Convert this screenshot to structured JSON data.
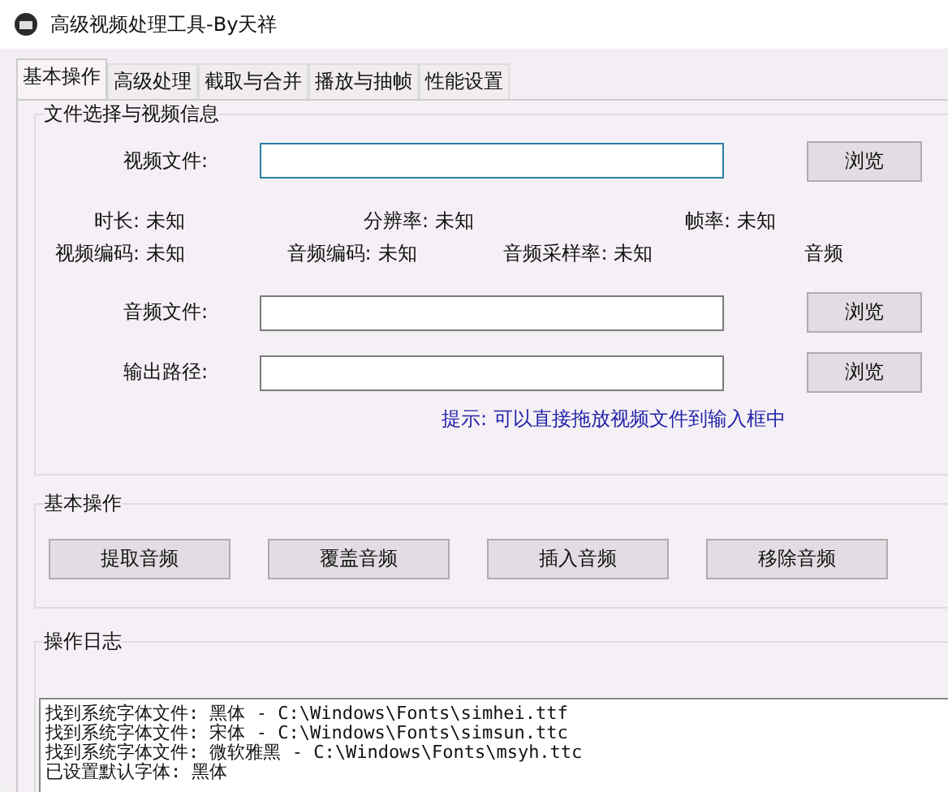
{
  "window": {
    "title": "高级视频处理工具-By天祥"
  },
  "tabs": [
    {
      "label": "基本操作",
      "selected": true
    },
    {
      "label": "高级处理",
      "selected": false
    },
    {
      "label": "截取与合并",
      "selected": false
    },
    {
      "label": "播放与抽帧",
      "selected": false
    },
    {
      "label": "性能设置",
      "selected": false
    }
  ],
  "file_group": {
    "title": "文件选择与视频信息",
    "file_rows": [
      {
        "label": "视频文件:",
        "focused": true,
        "button": "浏览"
      },
      {
        "label": "音频文件:",
        "focused": false,
        "button": "浏览"
      },
      {
        "label": "输出路径:",
        "focused": false,
        "button": "浏览"
      }
    ],
    "info_rows": [
      [
        {
          "label": "时长:",
          "value": "未知"
        },
        {
          "label": "分辨率:",
          "value": "未知"
        },
        {
          "label": "帧率:",
          "value": "未知"
        }
      ],
      [
        {
          "label": "视频编码:",
          "value": "未知"
        },
        {
          "label": "音频编码:",
          "value": "未知"
        },
        {
          "label": "音频采样率:",
          "value": "未知"
        },
        {
          "label": "音频"
        }
      ]
    ],
    "hint": "提示: 可以直接拖放视频文件到输入框中"
  },
  "ops_group": {
    "title": "基本操作",
    "buttons": [
      "提取音频",
      "覆盖音频",
      "插入音频",
      "移除音频"
    ]
  },
  "log_group": {
    "title": "操作日志",
    "lines": [
      "找到系统字体文件: 黑体 - C:\\Windows\\Fonts\\simhei.ttf",
      "找到系统字体文件: 宋体 - C:\\Windows\\Fonts\\simsun.ttc",
      "找到系统字体文件: 微软雅黑 - C:\\Windows\\Fonts\\msyh.ttc",
      "已设置默认字体: 黑体"
    ]
  }
}
